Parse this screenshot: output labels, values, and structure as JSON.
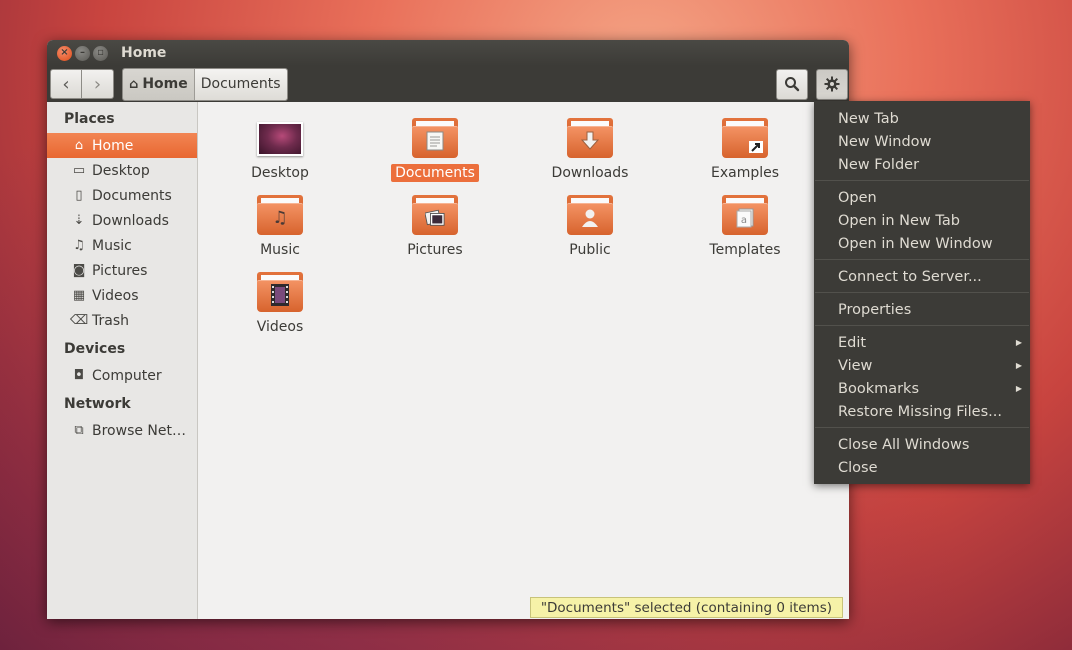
{
  "window": {
    "title": "Home"
  },
  "toolbar": {
    "back_icon": "‹",
    "forward_icon": "›",
    "breadcrumbs": [
      {
        "label": "Home",
        "icon": "home-icon",
        "active": true
      },
      {
        "label": "Documents",
        "active": false
      }
    ],
    "search_icon": "search-icon",
    "settings_icon": "gear-icon"
  },
  "sidebar": {
    "places_title": "Places",
    "places": [
      {
        "label": "Home",
        "icon": "⌂",
        "selected": true
      },
      {
        "label": "Desktop",
        "icon": "▭"
      },
      {
        "label": "Documents",
        "icon": "▯"
      },
      {
        "label": "Downloads",
        "icon": "⇣"
      },
      {
        "label": "Music",
        "icon": "♫"
      },
      {
        "label": "Pictures",
        "icon": "◙"
      },
      {
        "label": "Videos",
        "icon": "▦"
      },
      {
        "label": "Trash",
        "icon": "⌫"
      }
    ],
    "devices_title": "Devices",
    "devices": [
      {
        "label": "Computer",
        "icon": "◘"
      }
    ],
    "network_title": "Network",
    "network": [
      {
        "label": "Browse Net…",
        "icon": "⧉"
      }
    ]
  },
  "files": [
    {
      "name": "Desktop",
      "kind": "thumbnail"
    },
    {
      "name": "Documents",
      "kind": "folder",
      "emblem": "document-icon",
      "selected": true
    },
    {
      "name": "Downloads",
      "kind": "folder",
      "emblem": "download-icon"
    },
    {
      "name": "Examples",
      "kind": "folder",
      "emblem": "link-icon"
    },
    {
      "name": "Music",
      "kind": "folder",
      "emblem": "music-icon"
    },
    {
      "name": "Pictures",
      "kind": "folder",
      "emblem": "picture-icon"
    },
    {
      "name": "Public",
      "kind": "folder",
      "emblem": "person-icon"
    },
    {
      "name": "Templates",
      "kind": "folder",
      "emblem": "template-icon"
    },
    {
      "name": "Videos",
      "kind": "folder",
      "emblem": "film-icon"
    }
  ],
  "status": "\"Documents\" selected (containing 0 items)",
  "menu": {
    "groups": [
      [
        {
          "label": "New Tab"
        },
        {
          "label": "New Window"
        },
        {
          "label": "New Folder"
        }
      ],
      [
        {
          "label": "Open"
        },
        {
          "label": "Open in New Tab"
        },
        {
          "label": "Open in New Window"
        }
      ],
      [
        {
          "label": "Connect to Server..."
        }
      ],
      [
        {
          "label": "Properties"
        }
      ],
      [
        {
          "label": "Edit",
          "submenu": true
        },
        {
          "label": "View",
          "submenu": true
        },
        {
          "label": "Bookmarks",
          "submenu": true
        },
        {
          "label": "Restore Missing Files..."
        }
      ],
      [
        {
          "label": "Close All Windows"
        },
        {
          "label": "Close"
        }
      ]
    ]
  },
  "colors": {
    "accent": "#e86731",
    "titlebar": "#3c3b37",
    "status_bg": "#f6f2a8"
  }
}
